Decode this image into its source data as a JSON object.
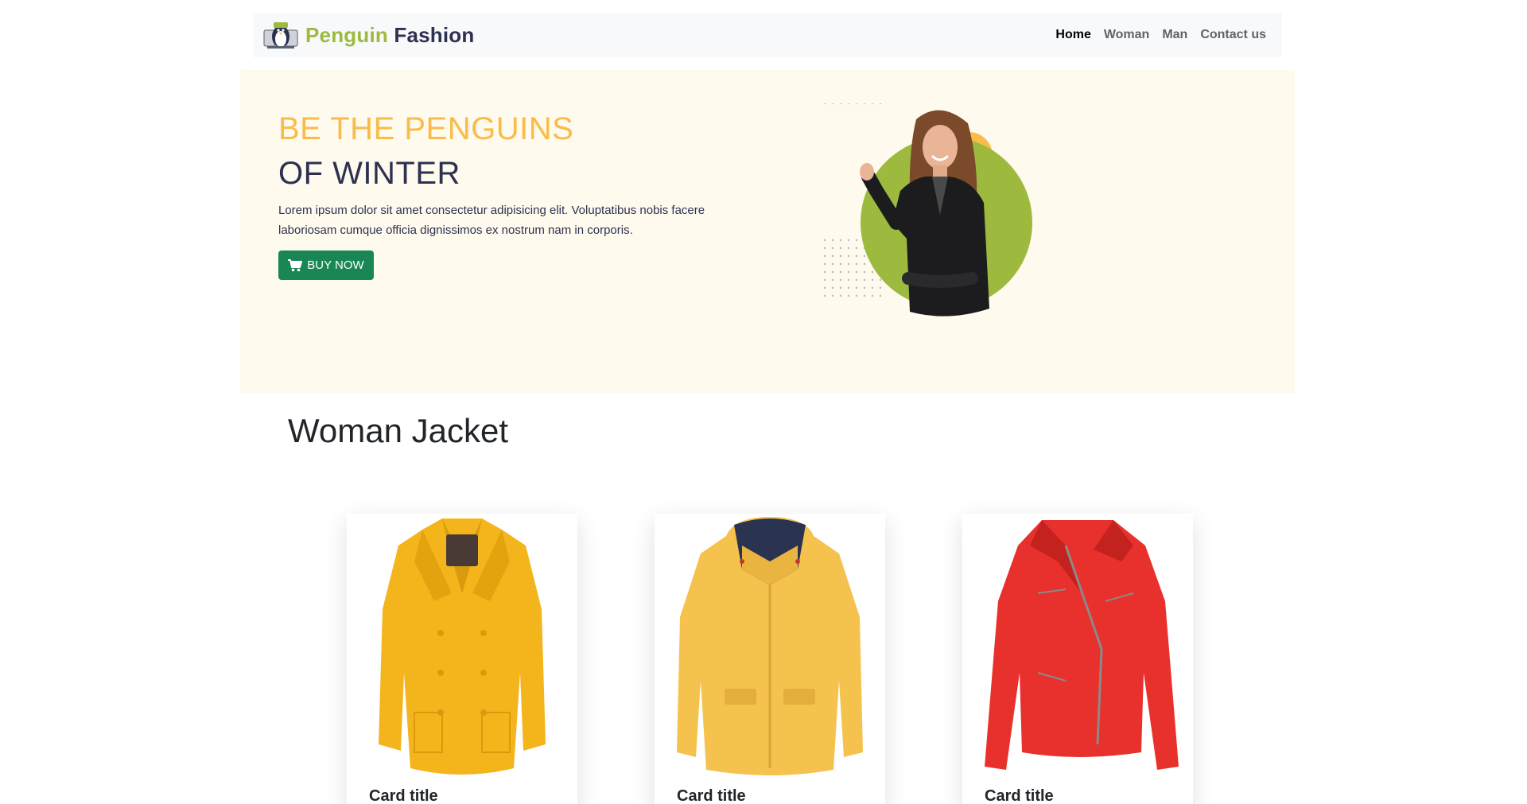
{
  "navbar": {
    "brand_part1": "Penguin",
    "brand_part2": "Fashion",
    "logo_icon": "penguin-logo-icon",
    "links": [
      {
        "label": "Home",
        "active": true
      },
      {
        "label": "Woman",
        "active": false
      },
      {
        "label": "Man",
        "active": false
      },
      {
        "label": "Contact us",
        "active": false
      }
    ]
  },
  "hero": {
    "title_line1": "BE THE PENGUINS",
    "title_line2": "OF WINTER",
    "text_line1": "Lorem ipsum dolor sit amet consectetur adipisicing elit. Voluptatibus nobis facere",
    "text_line2": "laboriosam cumque officia dignissimos ex nostrum nam in corporis.",
    "button_label": "BUY NOW",
    "button_icon": "cart-icon",
    "image": "woman-leather-jacket-photo"
  },
  "section": {
    "title": "Woman Jacket"
  },
  "cards": [
    {
      "title": "Card title",
      "image": "yellow-peacoat-image",
      "color": "#f4b51c"
    },
    {
      "title": "Card title",
      "image": "yellow-hooded-jacket-image",
      "color": "#f5c24e"
    },
    {
      "title": "Card title",
      "image": "red-leather-jacket-image",
      "color": "#e8302c"
    }
  ],
  "colors": {
    "brand_green": "#9dba3f",
    "brand_dark": "#2d3150",
    "accent_yellow": "#f9bc4a",
    "hero_bg": "#fffaee",
    "button_green": "#198754"
  }
}
